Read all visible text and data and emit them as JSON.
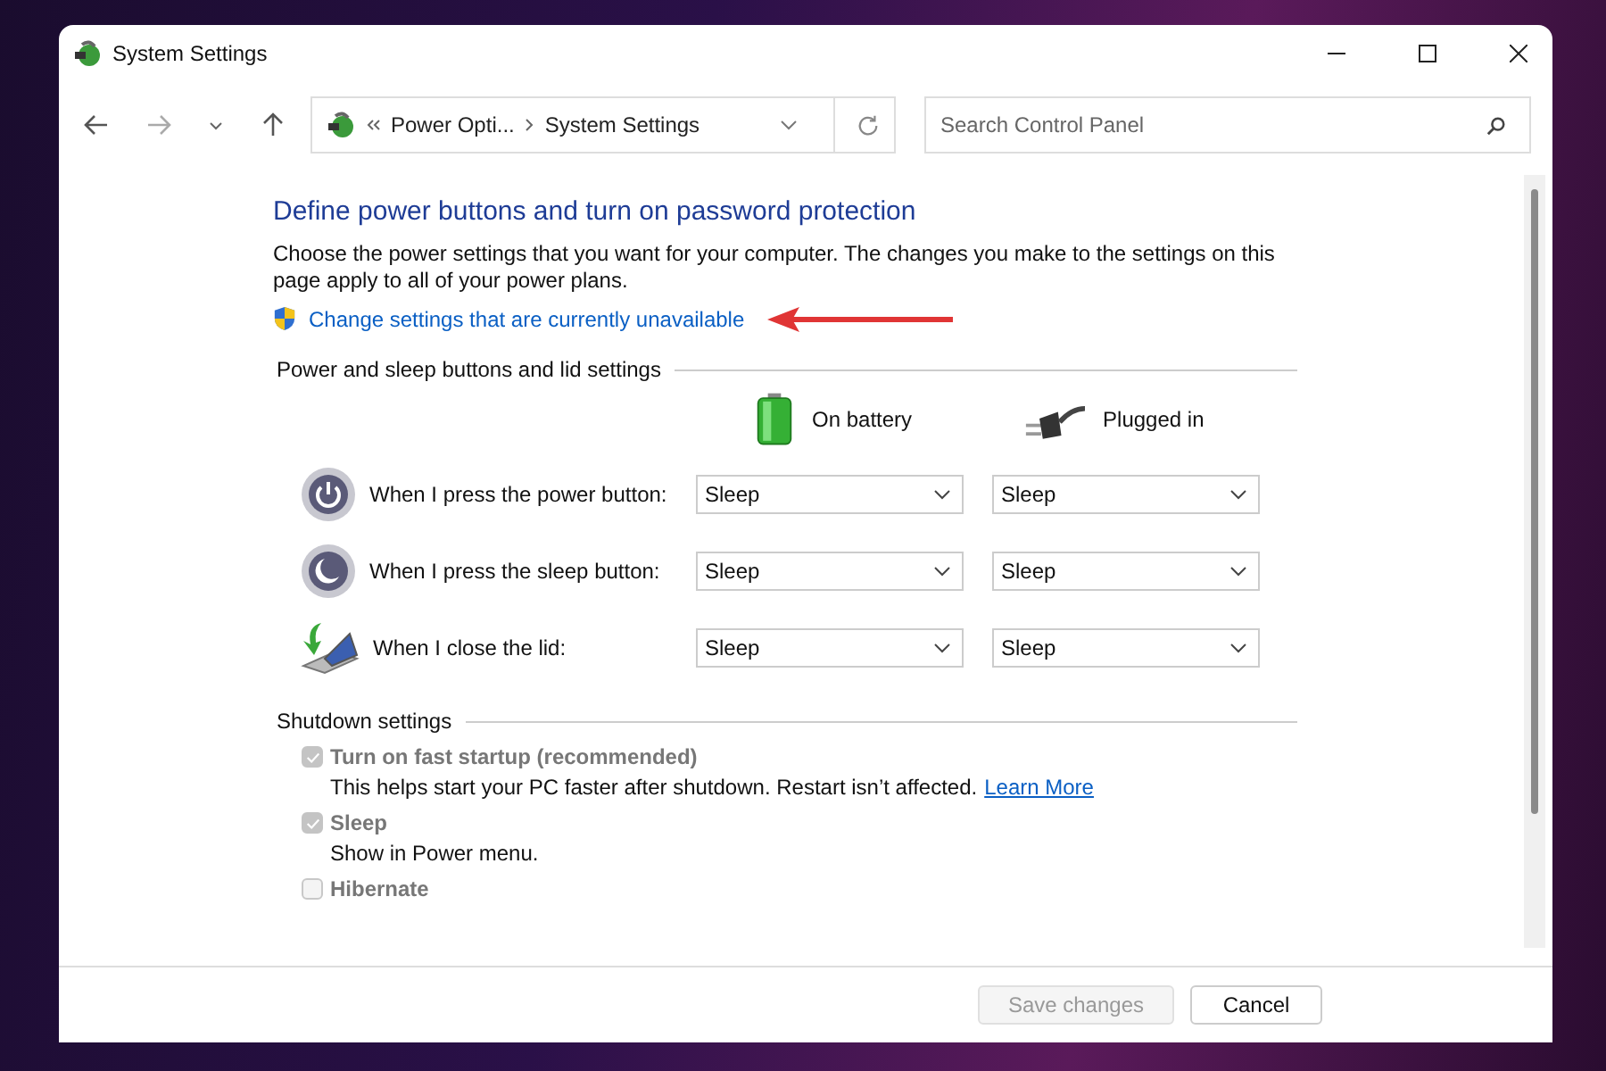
{
  "window": {
    "title": "System Settings"
  },
  "address_bar": {
    "segments": [
      "Power Opti...",
      "System Settings"
    ]
  },
  "search": {
    "placeholder": "Search Control Panel"
  },
  "content": {
    "heading": "Define power buttons and turn on password protection",
    "description": "Choose the power settings that you want for your computer. The changes you make to the settings on this page apply to all of your power plans.",
    "link": "Change settings that are currently unavailable"
  },
  "power_section": {
    "title": "Power and sleep buttons and lid settings",
    "columns": [
      {
        "label": "On battery",
        "kind": "battery"
      },
      {
        "label": "Plugged in",
        "kind": "plug"
      }
    ],
    "rows": [
      {
        "label": "When I press the power button:",
        "kind": "power",
        "values": [
          "Sleep",
          "Sleep"
        ]
      },
      {
        "label": "When I press the sleep button:",
        "kind": "sleep",
        "values": [
          "Sleep",
          "Sleep"
        ]
      },
      {
        "label": "When I close the lid:",
        "kind": "lid",
        "values": [
          "Sleep",
          "Sleep"
        ]
      }
    ]
  },
  "shutdown_section": {
    "title": "Shutdown settings",
    "options": [
      {
        "label": "Turn on fast startup (recommended)",
        "checked": true,
        "disabled": true,
        "description": "This helps start your PC faster after shutdown. Restart isn’t affected.",
        "link": "Learn More"
      },
      {
        "label": "Sleep",
        "checked": true,
        "disabled": true,
        "description": "Show in Power menu."
      },
      {
        "label": "Hibernate",
        "checked": false,
        "disabled": true
      }
    ]
  },
  "buttons": [
    {
      "label": "Save changes",
      "disabled": true
    },
    {
      "label": "Cancel",
      "disabled": false
    }
  ]
}
